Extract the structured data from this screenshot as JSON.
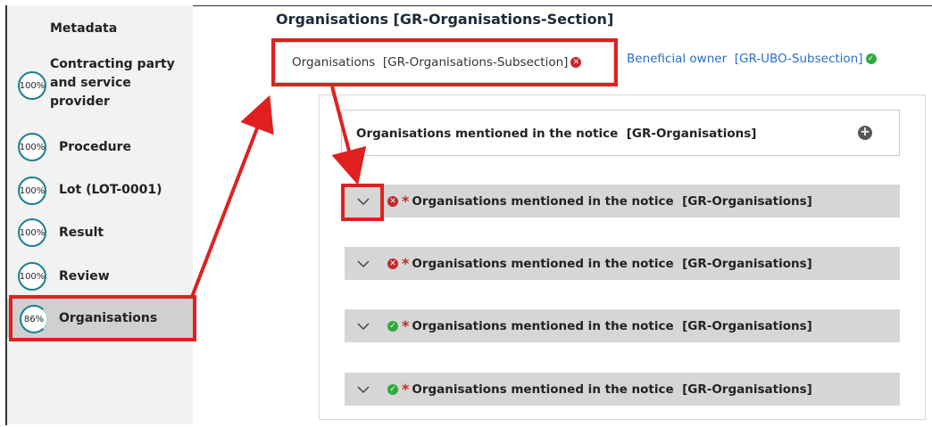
{
  "sidebar": {
    "metadata_label": "Metadata",
    "items": [
      {
        "progress": "100%",
        "label": "Contracting party and service provider",
        "label_lines": [
          "Contracting party",
          "and service",
          "provider"
        ]
      },
      {
        "progress": "100%",
        "label": "Procedure"
      },
      {
        "progress": "100%",
        "label": "Lot (LOT-0001)"
      },
      {
        "progress": "100%",
        "label": "Result"
      },
      {
        "progress": "100%",
        "label": "Review"
      },
      {
        "progress": "86%",
        "label": "Organisations",
        "active": true
      }
    ]
  },
  "section": {
    "title": "Organisations [GR-Organisations-Section]"
  },
  "tabs": [
    {
      "label": "Organisations  [GR-Organisations-Subsection]",
      "status": "error",
      "active": true
    },
    {
      "label": "Beneficial owner  [GR-UBO-Subsection]",
      "status": "ok",
      "active": false
    }
  ],
  "group_header": {
    "label": "Organisations mentioned in the notice  [GR-Organisations]",
    "add_icon": "plus-circle-icon"
  },
  "rows": [
    {
      "label": "Organisations mentioned in the notice  [GR-Organisations]",
      "status": "error",
      "required_marker": "*"
    },
    {
      "label": "Organisations mentioned in the notice  [GR-Organisations]",
      "status": "error",
      "required_marker": "*"
    },
    {
      "label": "Organisations mentioned in the notice  [GR-Organisations]",
      "status": "ok",
      "required_marker": "*"
    },
    {
      "label": "Organisations mentioned in the notice  [GR-Organisations]",
      "status": "ok",
      "required_marker": "*"
    }
  ],
  "colors": {
    "annotation_red": "#e02020",
    "error_red": "#c62828",
    "ok_green": "#2eaa3e",
    "progress_ring": "#1a7f8f",
    "link_blue": "#2a6ec7"
  }
}
